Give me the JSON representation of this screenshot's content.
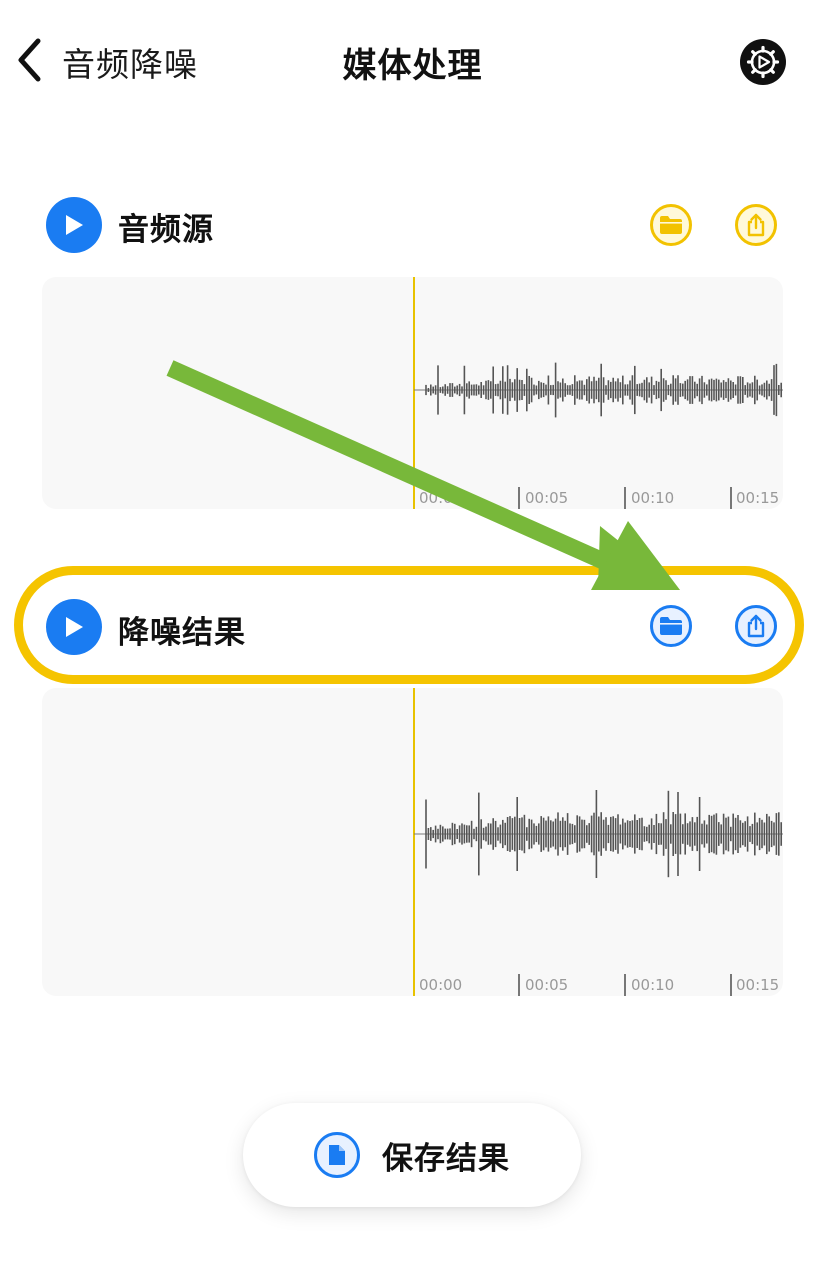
{
  "header": {
    "back_label": "音频降噪",
    "title": "媒体处理"
  },
  "source_row": {
    "label": "音频源"
  },
  "result_row": {
    "label": "降噪结果"
  },
  "timeline": {
    "ticks": [
      "00:00",
      "00:05",
      "00:10",
      "00:15"
    ]
  },
  "save_button": {
    "label": "保存结果"
  },
  "colors": {
    "accent_blue": "#1a7cf2",
    "accent_yellow": "#f5c400",
    "annotation_green": "#78b83a",
    "waveform": "#555555"
  },
  "icons": {
    "back": "chevron-left-icon",
    "settings": "gear-play-icon",
    "play": "play-icon",
    "folder": "folder-icon",
    "share": "share-icon",
    "document": "document-icon"
  }
}
